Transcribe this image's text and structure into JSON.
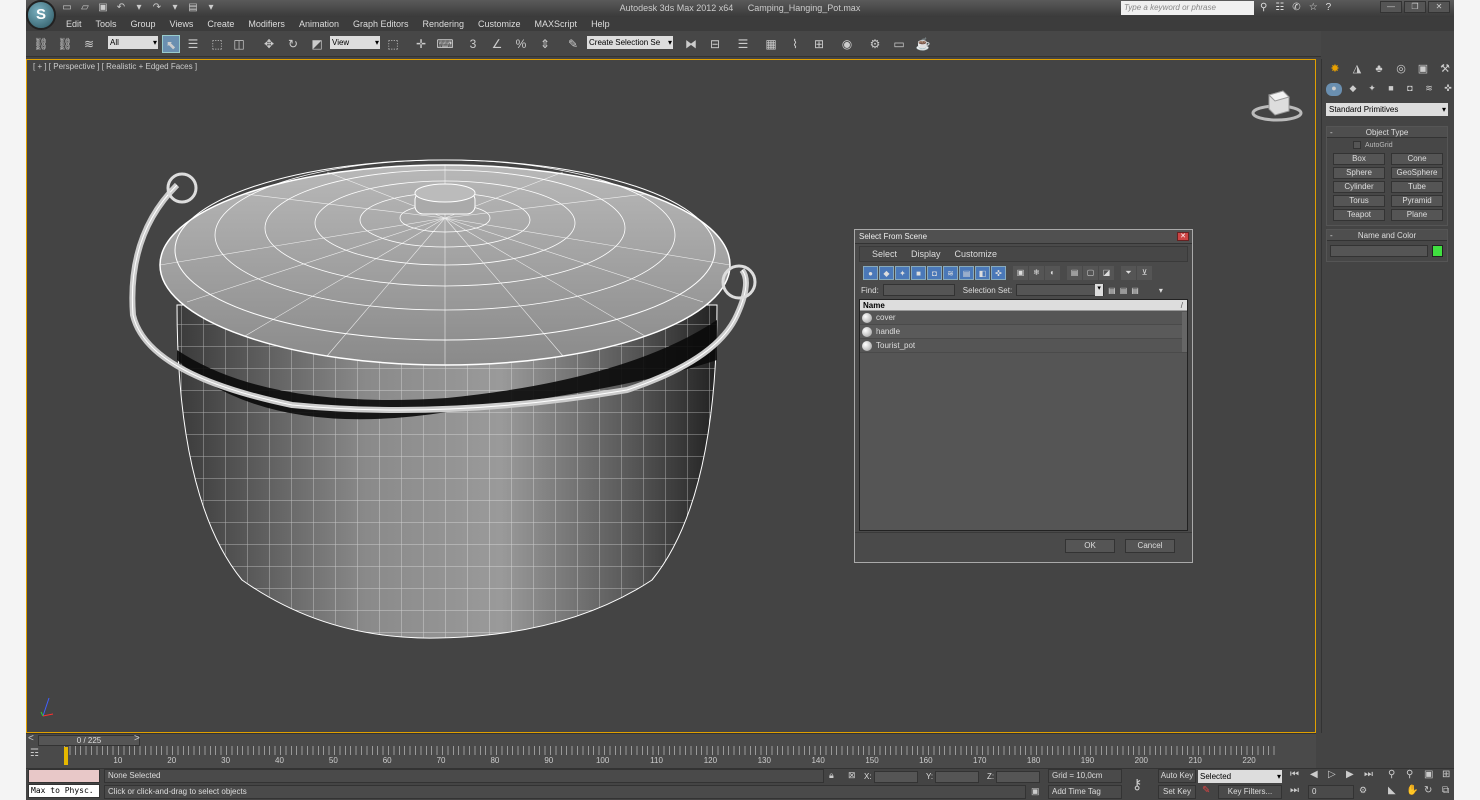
{
  "app": {
    "logo": "S",
    "title": "Autodesk 3ds Max  2012 x64",
    "file": "Camping_Hanging_Pot.max",
    "search_placeholder": "Type a keyword or phrase"
  },
  "menu": [
    "Edit",
    "Tools",
    "Group",
    "Views",
    "Create",
    "Modifiers",
    "Animation",
    "Graph Editors",
    "Rendering",
    "Customize",
    "MAXScript",
    "Help"
  ],
  "toolbar": {
    "filter": "All",
    "ref_coord": "View",
    "selection_set": "Create Selection Se"
  },
  "viewport": {
    "label": "[ + ] [ Perspective ] [ Realistic + Edged Faces ]",
    "viewcube_face": "BACK"
  },
  "command_panel": {
    "category": "Standard Primitives",
    "object_type_title": "Object Type",
    "autogrid": "AutoGrid",
    "primitives": [
      "Box",
      "Cone",
      "Sphere",
      "GeoSphere",
      "Cylinder",
      "Tube",
      "Torus",
      "Pyramid",
      "Teapot",
      "Plane"
    ],
    "name_color_title": "Name and Color",
    "color": "#40e040"
  },
  "dialog": {
    "title": "Select From Scene",
    "menus": [
      "Select",
      "Display",
      "Customize"
    ],
    "find_label": "Find:",
    "selection_set_label": "Selection Set:",
    "column": "Name",
    "items": [
      "cover",
      "handle",
      "Tourist_pot"
    ],
    "ok": "OK",
    "cancel": "Cancel"
  },
  "timeline": {
    "frame": "0 / 225",
    "ticks": [
      "10",
      "20",
      "30",
      "40",
      "50",
      "60",
      "70",
      "80",
      "90",
      "100",
      "110",
      "120",
      "130",
      "140",
      "150",
      "160",
      "170",
      "180",
      "190",
      "200",
      "210",
      "220"
    ]
  },
  "status": {
    "maxscript": "Max to Physc.",
    "selection": "None Selected",
    "prompt": "Click or click-and-drag to select objects",
    "x_label": "X:",
    "y_label": "Y:",
    "z_label": "Z:",
    "grid": "Grid = 10,0cm",
    "add_time_tag": "Add Time Tag",
    "auto_key": "Auto Key",
    "set_key": "Set Key",
    "key_mode": "Selected",
    "key_filters": "Key Filters...",
    "frame_value": "0"
  }
}
